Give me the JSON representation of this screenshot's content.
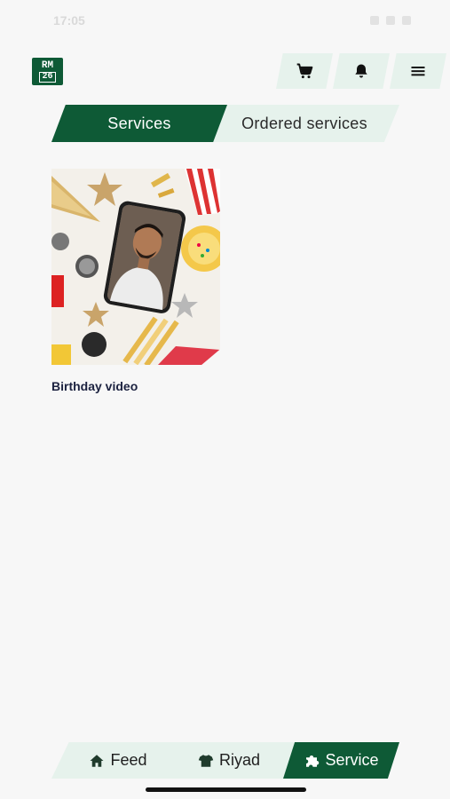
{
  "status": {
    "time": "17:05"
  },
  "header": {
    "logo_line1": "RM",
    "logo_line2": "26",
    "icons": [
      "cart-icon",
      "bell-icon",
      "menu-icon"
    ]
  },
  "tabs": [
    {
      "label": "Services",
      "active": true
    },
    {
      "label": "Ordered services",
      "active": false
    }
  ],
  "services": [
    {
      "title": "Birthday video"
    }
  ],
  "bottom_nav": [
    {
      "label": "Feed",
      "icon": "home-icon",
      "active": false
    },
    {
      "label": "Riyad",
      "icon": "shirt-icon",
      "active": false
    },
    {
      "label": "Service",
      "icon": "puzzle-icon",
      "active": true
    }
  ],
  "colors": {
    "brand_green": "#0e5a36",
    "light_green": "#e6f2ec",
    "background": "#f7f7f7",
    "title_text": "#1c2240"
  }
}
